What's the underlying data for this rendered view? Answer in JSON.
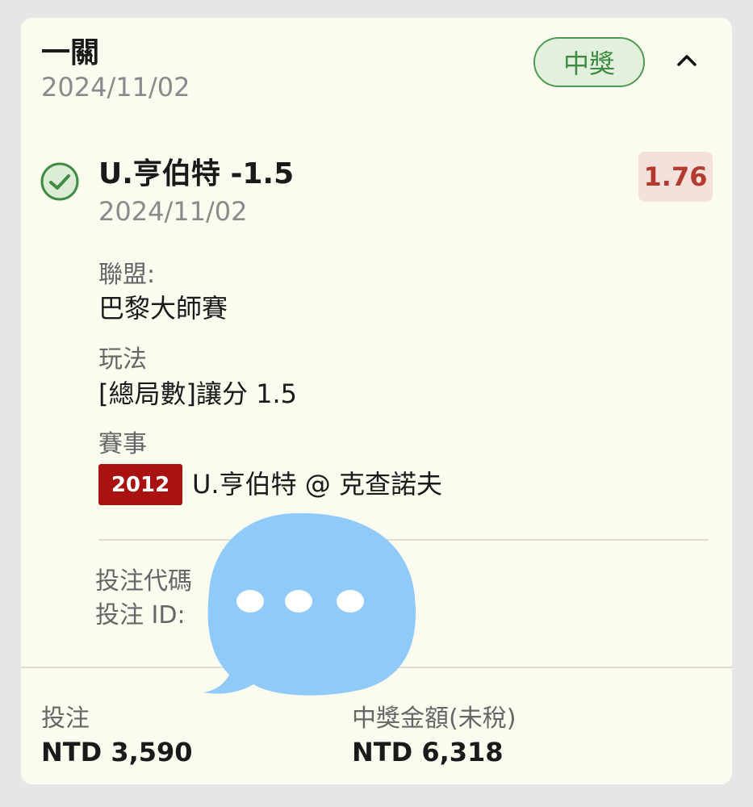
{
  "ticket": {
    "title": "一關",
    "date": "2024/11/02",
    "status_badge": "中獎"
  },
  "selection": {
    "name": "U.亨伯特 -1.5",
    "date": "2024/11/02",
    "odds": "1.76",
    "league_label": "聯盟:",
    "league_value": "巴黎大師賽",
    "market_label": "玩法",
    "market_value": "[總局數]讓分 1.5",
    "event_label": "賽事",
    "event_code": "2012",
    "event_name": "U.亨伯特 @ 克查諾夫"
  },
  "bet_info": {
    "code_label": "投注代碼",
    "id_label": "投注 ID:"
  },
  "footer": {
    "stake_label": "投注",
    "stake_value": "NTD 3,590",
    "payout_label": "中獎金額(未稅)",
    "payout_value": "NTD 6,318"
  },
  "colors": {
    "win_green": "#4f9a52",
    "odds_red": "#b23a2e",
    "event_code_bg": "#a81210",
    "overlay_blue": "#90caf9"
  },
  "icons": {
    "collapse": "chevron-up-icon",
    "selection_status": "check-circle-icon",
    "overlay": "chat-bubble-icon"
  }
}
